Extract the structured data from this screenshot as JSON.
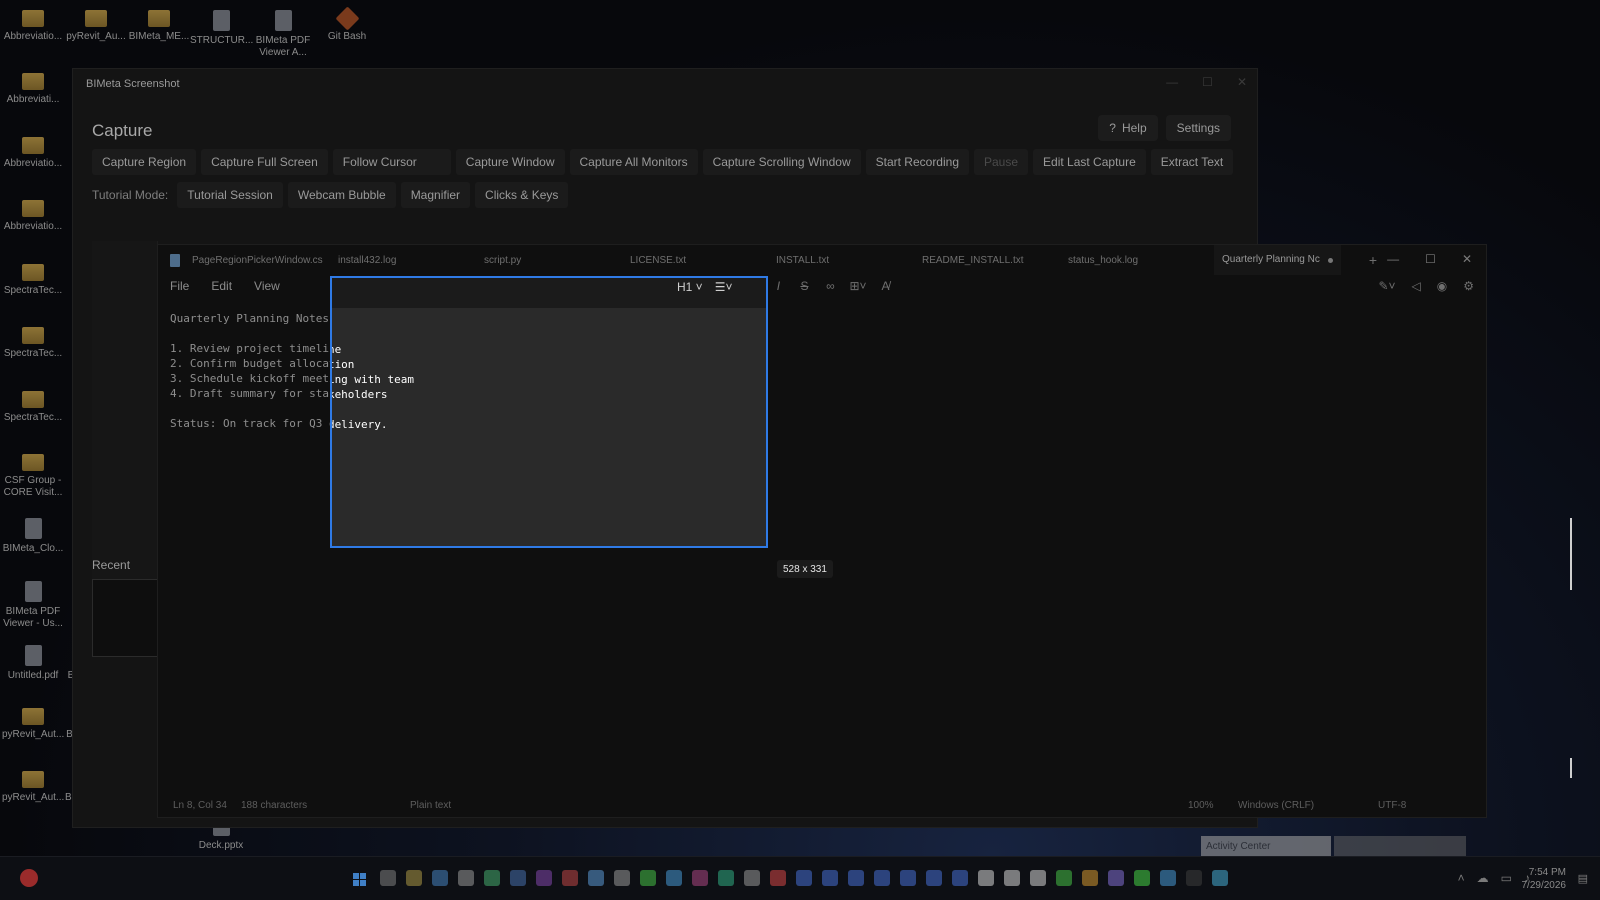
{
  "desktop": {
    "icons": [
      {
        "label": "Abbreviatio...",
        "type": "folder"
      },
      {
        "label": "pyRevit_Au...",
        "type": "folder"
      },
      {
        "label": "BIMeta_ME...",
        "type": "folder"
      },
      {
        "label": "STRUCTUR...",
        "type": "file"
      },
      {
        "label": "BIMeta PDF Viewer A...",
        "type": "file"
      },
      {
        "label": "Git Bash",
        "type": "app-git"
      },
      {
        "label": "Abbreviati...",
        "type": "folder"
      },
      {
        "label": "Abbreviatio...",
        "type": "folder"
      },
      {
        "label": "Abbreviatio...",
        "type": "folder"
      },
      {
        "label": "SpectraTec...",
        "type": "folder"
      },
      {
        "label": "SpectraTec...",
        "type": "folder"
      },
      {
        "label": "SpectraTec...",
        "type": "folder"
      },
      {
        "label": "CSF Group - CORE Visit...",
        "type": "folder"
      },
      {
        "label": "BIMeta_Clo...",
        "type": "file"
      },
      {
        "label": "BIMeta PDF Viewer - Us...",
        "type": "file"
      },
      {
        "label": "Untitled.pdf",
        "type": "file"
      },
      {
        "label": "BIMeta_Int...",
        "type": "file"
      },
      {
        "label": "pyRevit_Aut...",
        "type": "folder"
      },
      {
        "label": "BIMeta_Trif...",
        "type": "app-red"
      },
      {
        "label": "pyRevit_Aut...",
        "type": "folder"
      },
      {
        "label": "BIMeta_PDF...",
        "type": "folder"
      },
      {
        "label": "Deck.pptx",
        "type": "file"
      }
    ]
  },
  "capture_window": {
    "title": "BIMeta Screenshot",
    "heading": "Capture",
    "help_label": "Help",
    "settings_label": "Settings",
    "actions": [
      "Capture Region",
      "Capture Full Screen",
      "Follow Cursor",
      "Capture Window",
      "Capture All Monitors",
      "Capture Scrolling Window",
      "Start Recording",
      "Pause",
      "Edit Last Capture",
      "Extract Text"
    ],
    "tutorial_label": "Tutorial Mode:",
    "tutorial_actions": [
      "Tutorial Session",
      "Webcam Bubble",
      "Magnifier",
      "Clicks & Keys"
    ],
    "recent_label": "Recent"
  },
  "editor": {
    "tabs": [
      "PageRegionPickerWindow.cs",
      "install432.log",
      "script.py",
      "LICENSE.txt",
      "INSTALL.txt",
      "README_INSTALL.txt",
      "status_hook.log"
    ],
    "active_tab": "Quarterly Planning Nc",
    "menu": [
      "File",
      "Edit",
      "View"
    ],
    "heading_select": "H1",
    "lines": [
      "Quarterly Planning Notes",
      "",
      "1. Review project timeline",
      "2. Confirm budget allocation",
      "3. Schedule kickoff meeting with team",
      "4. Draft summary for stakeholders",
      "",
      "Status: On track for Q3 delivery."
    ],
    "status": {
      "position": "Ln 8, Col 34",
      "chars": "188 characters",
      "mode": "Plain text",
      "zoom": "100%",
      "eol": "Windows (CRLF)",
      "encoding": "UTF-8"
    }
  },
  "selection": {
    "size_label": "528 x 331"
  },
  "taskbar": {
    "activity_label": "Activity Center",
    "time": "7:54 PM",
    "date": "7/29/2026"
  }
}
